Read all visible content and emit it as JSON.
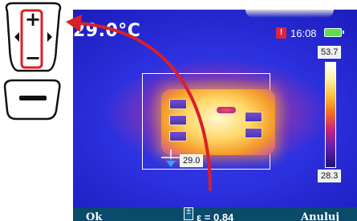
{
  "screen": {
    "temperature_readout": "29.0°C",
    "clock": "16:08",
    "battery_alert_icon": "battery-alert-icon",
    "battery_icon": "battery-icon"
  },
  "measurement": {
    "cold_spot_value": "29.0"
  },
  "color_scale": {
    "max": "53.7",
    "min": "28.3"
  },
  "softkeys": {
    "left": "Ok",
    "center_value": "ε = 0.84",
    "right": "Anuluj"
  },
  "keypad": {
    "plus_symbol": "+",
    "minus_symbol": "−"
  },
  "colors": {
    "annotation_red": "#d8202a",
    "softkey_bar": "#0a4a6a",
    "battery_green": "#5edc52"
  }
}
